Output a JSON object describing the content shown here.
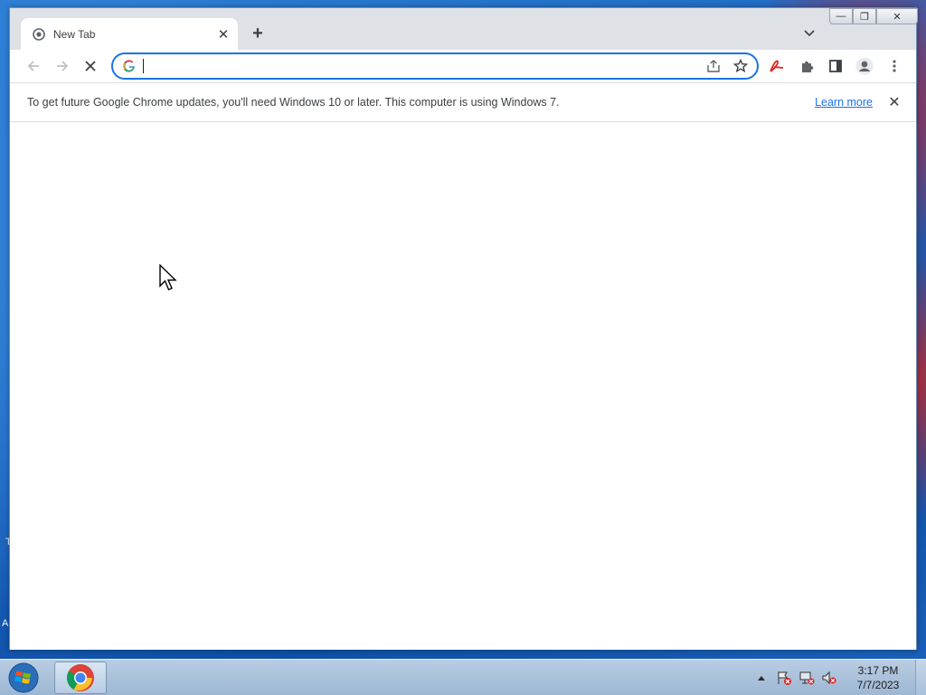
{
  "desktop": {
    "edge_text_1": "T",
    "edge_text_2": "A"
  },
  "tab": {
    "title": "New Tab",
    "close_label": "✕"
  },
  "toolbar": {
    "new_tab_label": "+",
    "omnibox_value": "",
    "omnibox_placeholder": ""
  },
  "infobar": {
    "message": "To get future Google Chrome updates, you'll need Windows 10 or later. This computer is using Windows 7.",
    "link_label": "Learn more",
    "close_label": "✕"
  },
  "window_controls": {
    "minimize": "—",
    "restore": "❐",
    "close": "✕"
  },
  "taskbar": {
    "time": "3:17 PM",
    "date": "7/7/2023"
  },
  "colors": {
    "accent": "#1a73e8",
    "titlebar": "#dee1e6",
    "taskbar": "#9db7d3"
  }
}
